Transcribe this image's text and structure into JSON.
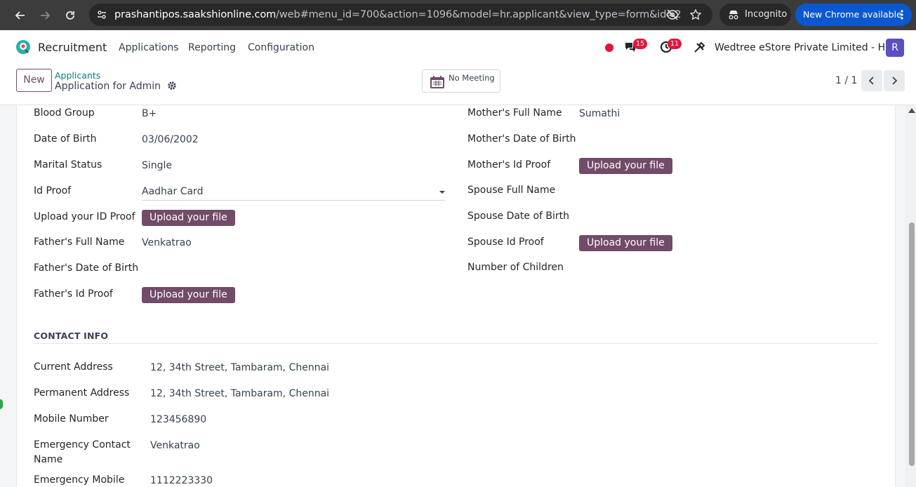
{
  "browser": {
    "url_host": "prashantipos.saakshionline.com",
    "url_path": "/web#menu_id=700&action=1096&model=hr.applicant&view_type=form&id=2",
    "incognito_label": "Incognito",
    "update_label": "New Chrome available"
  },
  "navbar": {
    "app_name": "Recruitment",
    "menu": [
      "Applications",
      "Reporting",
      "Configuration"
    ],
    "messages_count": "15",
    "activities_count": "11",
    "company": "Wedtree eStore Private Limited - HO",
    "avatar_letter": "R"
  },
  "control_panel": {
    "new_label": "New",
    "breadcrumb_parent": "Applicants",
    "breadcrumb_current": "Application for Admin",
    "meeting_label": "No Meeting",
    "pager": "1 / 1"
  },
  "form": {
    "left": [
      {
        "label": "Blood Group",
        "value": "B+"
      },
      {
        "label": "Date of Birth",
        "value": "03/06/2002"
      },
      {
        "label": "Marital Status",
        "value": "Single"
      },
      {
        "label": "Id Proof",
        "value": "Aadhar Card"
      },
      {
        "label": "Upload your ID Proof",
        "button": "Upload your file"
      },
      {
        "label": "Father's Full Name",
        "value": "Venkatrao"
      },
      {
        "label": "Father's Date of Birth",
        "value": ""
      },
      {
        "label": "Father's Id Proof",
        "button": "Upload your file"
      }
    ],
    "right": [
      {
        "label": "Mother's Full Name",
        "value": "Sumathi"
      },
      {
        "label": "Mother's Date of Birth",
        "value": ""
      },
      {
        "label": "Mother's Id Proof",
        "button": "Upload your file"
      },
      {
        "label": "Spouse Full Name",
        "value": ""
      },
      {
        "label": "Spouse Date of Birth",
        "value": ""
      },
      {
        "label": "Spouse Id Proof",
        "button": "Upload your file"
      },
      {
        "label": "Number of Children",
        "value": ""
      }
    ],
    "contact_title": "CONTACT INFO",
    "contact": [
      {
        "label": "Current Address",
        "value": "12, 34th Street, Tambaram, Chennai"
      },
      {
        "label": "Permanent Address",
        "value": "12, 34th Street, Tambaram, Chennai"
      },
      {
        "label": "Mobile Number",
        "value": "123456890"
      },
      {
        "label": "Emergency Contact",
        "label2": "Name",
        "value": "Venkatrao"
      },
      {
        "label": "Emergency Mobile",
        "value": "1112223330"
      }
    ]
  },
  "colors": {
    "primary": "#714b67",
    "link": "#017e84",
    "badge": "#e0173a"
  }
}
